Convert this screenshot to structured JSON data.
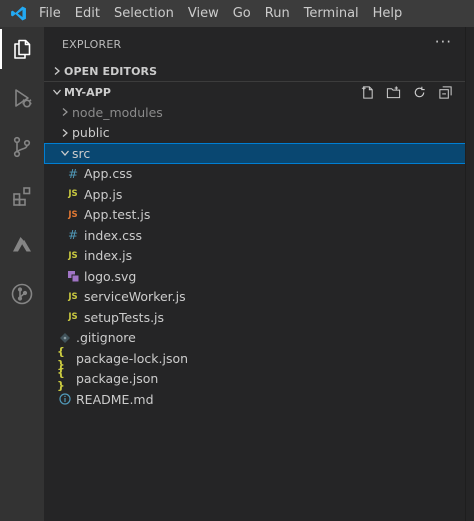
{
  "menu": {
    "items": [
      "File",
      "Edit",
      "Selection",
      "View",
      "Go",
      "Run",
      "Terminal",
      "Help"
    ]
  },
  "activity_bar": {
    "icons": [
      "files-icon",
      "run-debug-icon",
      "source-control-icon",
      "extensions-icon",
      "azure-icon",
      "git-lens-icon"
    ],
    "active_index": 0
  },
  "sidebar": {
    "title": "EXPLORER",
    "more_label": "···",
    "open_editors_label": "OPEN EDITORS",
    "project_label": "MY-APP",
    "project_actions": [
      "new-file-icon",
      "new-folder-icon",
      "refresh-icon",
      "collapse-all-icon"
    ],
    "tree": [
      {
        "label": "node_modules",
        "type": "folder",
        "expanded": false,
        "depth": 0,
        "dim": true
      },
      {
        "label": "public",
        "type": "folder",
        "expanded": false,
        "depth": 0
      },
      {
        "label": "src",
        "type": "folder",
        "expanded": true,
        "depth": 0,
        "selected": true
      },
      {
        "label": "App.css",
        "type": "css",
        "depth": 1
      },
      {
        "label": "App.js",
        "type": "js",
        "depth": 1
      },
      {
        "label": "App.test.js",
        "type": "testjs",
        "depth": 1
      },
      {
        "label": "index.css",
        "type": "css",
        "depth": 1
      },
      {
        "label": "index.js",
        "type": "js",
        "depth": 1
      },
      {
        "label": "logo.svg",
        "type": "svg",
        "depth": 1
      },
      {
        "label": "serviceWorker.js",
        "type": "js",
        "depth": 1
      },
      {
        "label": "setupTests.js",
        "type": "js",
        "depth": 1
      },
      {
        "label": ".gitignore",
        "type": "git",
        "depth": 0
      },
      {
        "label": "package-lock.json",
        "type": "json",
        "depth": 0
      },
      {
        "label": "package.json",
        "type": "json",
        "depth": 0
      },
      {
        "label": "README.md",
        "type": "info",
        "depth": 0
      }
    ]
  },
  "colors": {
    "titlebar": "#3c3c3c",
    "activitybar": "#333333",
    "sidebar": "#252526",
    "selection": "#094771",
    "selection_border": "#007fd4",
    "css_icon": "#519aba",
    "js_icon": "#cbcb41",
    "testjs_icon": "#e37933",
    "svg_icon": "#a074c4",
    "vscode_blue": "#23a9f2"
  },
  "icon_glyphs": {
    "css": "#",
    "js": "JS",
    "testjs": "JS",
    "json": "{ }"
  }
}
